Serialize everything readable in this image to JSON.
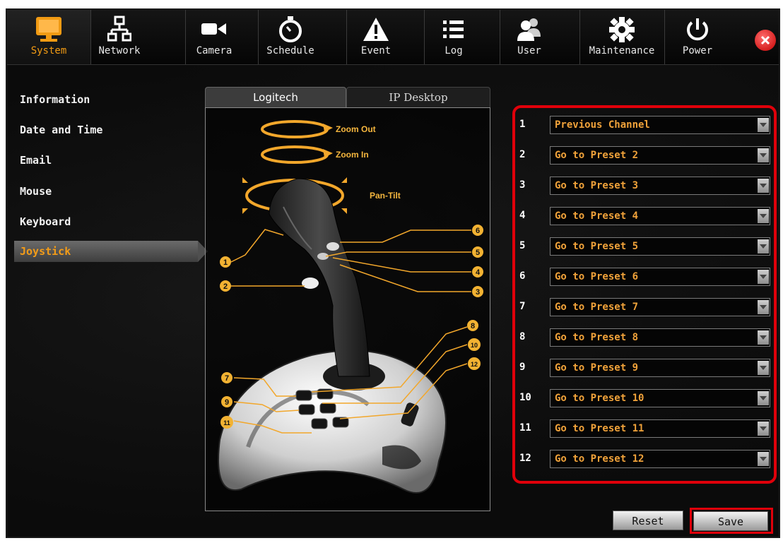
{
  "toolbar": {
    "tabs": [
      {
        "label": "System",
        "icon": "monitor-icon",
        "active": true
      },
      {
        "label": "Network",
        "icon": "network-icon"
      },
      {
        "label": "Camera",
        "icon": "camera-icon"
      },
      {
        "label": "Schedule",
        "icon": "stopwatch-icon"
      },
      {
        "label": "Event",
        "icon": "warning-icon"
      },
      {
        "label": "Log",
        "icon": "list-icon"
      },
      {
        "label": "User",
        "icon": "users-icon"
      },
      {
        "label": "Maintenance",
        "icon": "gear-icon"
      },
      {
        "label": "Power",
        "icon": "power-icon"
      }
    ],
    "close_icon": "close-icon"
  },
  "sidebar": {
    "items": [
      {
        "label": "Information"
      },
      {
        "label": "Date and Time"
      },
      {
        "label": "Email"
      },
      {
        "label": "Mouse"
      },
      {
        "label": "Keyboard"
      },
      {
        "label": "Joystick",
        "active": true
      }
    ]
  },
  "panel": {
    "tabs": [
      {
        "label": "Logitech",
        "active": true
      },
      {
        "label": "IP Desktop"
      }
    ],
    "joystick_labels": {
      "zoom_out": "Zoom Out",
      "zoom_in": "Zoom In",
      "pan_tilt": "Pan-Tilt"
    },
    "button_numbers": [
      "1",
      "2",
      "3",
      "4",
      "5",
      "6",
      "7",
      "8",
      "9",
      "10",
      "11",
      "12"
    ]
  },
  "mapping": {
    "rows": [
      {
        "number": "1",
        "value": "Previous Channel"
      },
      {
        "number": "2",
        "value": "Go to Preset 2"
      },
      {
        "number": "3",
        "value": "Go to Preset 3"
      },
      {
        "number": "4",
        "value": "Go to Preset 4"
      },
      {
        "number": "5",
        "value": "Go to Preset 5"
      },
      {
        "number": "6",
        "value": "Go to Preset 6"
      },
      {
        "number": "7",
        "value": "Go to Preset 7"
      },
      {
        "number": "8",
        "value": "Go to Preset 8"
      },
      {
        "number": "9",
        "value": "Go to Preset 9"
      },
      {
        "number": "10",
        "value": "Go to Preset 10"
      },
      {
        "number": "11",
        "value": "Go to Preset 11"
      },
      {
        "number": "12",
        "value": "Go to Preset 12"
      }
    ]
  },
  "actions": {
    "reset_label": "Reset",
    "save_label": "Save"
  },
  "colors": {
    "accent": "#f29b13",
    "highlight": "#e0000a",
    "background": "#0b0b0b"
  }
}
